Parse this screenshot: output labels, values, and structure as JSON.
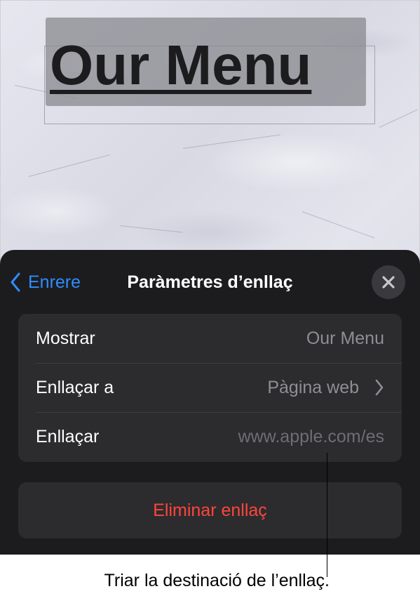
{
  "document": {
    "title": "Our Menu"
  },
  "link_settings_panel": {
    "back_label": "Enrere",
    "title": "Paràmetres d’enllaç",
    "rows": [
      {
        "label": "Mostrar",
        "value": "Our Menu"
      },
      {
        "label": "Enllaçar a",
        "value": "Pàgina web"
      },
      {
        "label": "Enllaçar",
        "value": "www.apple.com/es"
      }
    ],
    "remove_link_label": "Eliminar enllaç"
  },
  "callout": {
    "text": "Triar la destinació de l’enllaç."
  },
  "icons": {
    "back": "chevron-left-icon",
    "close": "close-icon",
    "disclosure": "chevron-right-icon"
  },
  "colors": {
    "accent": "#2f8cff",
    "destructive": "#ff453a",
    "sheet_background": "#1c1c1e",
    "group_background": "#2c2c2e",
    "secondary_text": "#8e8e93"
  }
}
